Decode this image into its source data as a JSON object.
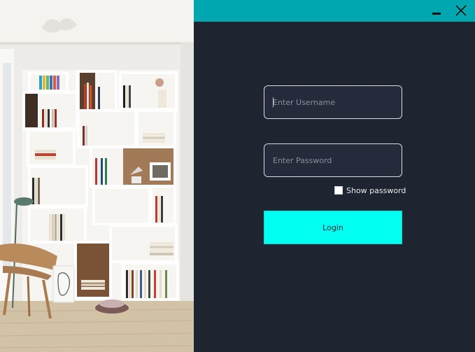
{
  "window": {
    "title_bar_color": "#00a7b1",
    "panel_bg": "#1f2530",
    "minimize_icon": "minimize-icon",
    "close_icon": "close-icon"
  },
  "login_form": {
    "username_placeholder": "Enter Username",
    "username_value": "",
    "password_placeholder": "Enter Password",
    "password_value": "",
    "show_password_label": "Show password",
    "show_password_checked": false,
    "login_button_label": "Login",
    "login_button_color": "#00fff1"
  }
}
